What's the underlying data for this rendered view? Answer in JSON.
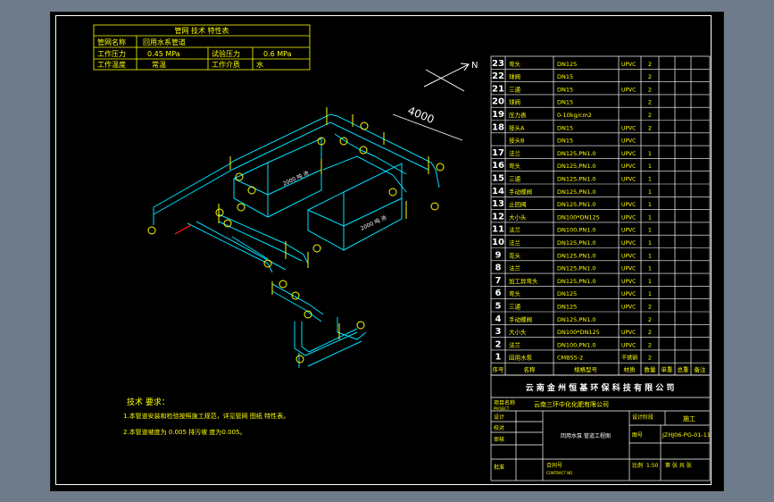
{
  "spec": {
    "title": "管网 技术 特性表",
    "rows": [
      [
        "管网名称",
        "回用水系管道",
        "",
        ""
      ],
      [
        "工作压力",
        "0.45 MPa",
        "试验压力",
        "0.6 MPa"
      ],
      [
        "工作温度",
        "常温",
        "工作介质",
        "水"
      ]
    ]
  },
  "north": "N",
  "dim_main": "4000",
  "tanks": [
    {
      "label": "2000 吨 池"
    },
    {
      "label": "2000 吨 池"
    }
  ],
  "notes": {
    "title": "技术 要求：",
    "items": [
      "1.本管道安装和检验按照施工规范，详见管网 图纸 特性表。",
      "2.本管道坡度为 0.005 排污坡 度为0.005。"
    ]
  },
  "bom": {
    "rows": [
      {
        "no": "23",
        "name": "弯头",
        "spec": "DN125",
        "mat": "UPVC",
        "qty": "2"
      },
      {
        "no": "22",
        "name": "球阀",
        "spec": "DN15",
        "mat": "",
        "qty": "2"
      },
      {
        "no": "21",
        "name": "三通",
        "spec": "DN15",
        "mat": "UPVC",
        "qty": "2"
      },
      {
        "no": "20",
        "name": "球阀",
        "spec": "DN15",
        "mat": "",
        "qty": "2"
      },
      {
        "no": "19",
        "name": "压力表",
        "spec": "0-10kg/cm2",
        "mat": "",
        "qty": "2"
      },
      {
        "no": "18",
        "name": "接头A",
        "spec": "DN15",
        "mat": "UPVC",
        "qty": "2"
      },
      {
        "no": "",
        "name": "接头B",
        "spec": "DN15",
        "mat": "UPVC",
        "qty": ""
      },
      {
        "no": "17",
        "name": "法兰",
        "spec": "DN125,PN1.0",
        "mat": "UPVC",
        "qty": "1"
      },
      {
        "no": "16",
        "name": "弯头",
        "spec": "DN125,PN1.0",
        "mat": "UPVC",
        "qty": "1"
      },
      {
        "no": "15",
        "name": "三通",
        "spec": "DN125,PN1.0",
        "mat": "UPVC",
        "qty": "1"
      },
      {
        "no": "14",
        "name": "手动蝶阀",
        "spec": "DN125,PN1.0",
        "mat": "",
        "qty": "1"
      },
      {
        "no": "13",
        "name": "止回阀",
        "spec": "DN125,PN1.0",
        "mat": "UPVC",
        "qty": "1"
      },
      {
        "no": "12",
        "name": "大小头",
        "spec": "DN100*DN125",
        "mat": "UPVC",
        "qty": "1"
      },
      {
        "no": "11",
        "name": "法兰",
        "spec": "DN100,PN1.0",
        "mat": "UPVC",
        "qty": "1"
      },
      {
        "no": "10",
        "name": "法兰",
        "spec": "DN125,PN1.0",
        "mat": "UPVC",
        "qty": "1"
      },
      {
        "no": "9",
        "name": "弯头",
        "spec": "DN125,PN1.0",
        "mat": "UPVC",
        "qty": "1"
      },
      {
        "no": "8",
        "name": "法兰",
        "spec": "DN125,PN1.0",
        "mat": "UPVC",
        "qty": "1"
      },
      {
        "no": "7",
        "name": "加工异弯头",
        "spec": "DN125,PN1.0",
        "mat": "UPVC",
        "qty": "1"
      },
      {
        "no": "6",
        "name": "弯头",
        "spec": "DN125",
        "mat": "UPVC",
        "qty": "1"
      },
      {
        "no": "5",
        "name": "三通",
        "spec": "DN125",
        "mat": "UPVC",
        "qty": "2"
      },
      {
        "no": "4",
        "name": "手动蝶阀",
        "spec": "DN125,PN1.0",
        "mat": "",
        "qty": "2"
      },
      {
        "no": "3",
        "name": "大小头",
        "spec": "DN100*DN125",
        "mat": "UPVC",
        "qty": "2"
      },
      {
        "no": "2",
        "name": "法兰",
        "spec": "DN100,PN1.0",
        "mat": "UPVC",
        "qty": "2"
      },
      {
        "no": "1",
        "name": "回用水泵",
        "spec": "CMBS5-2",
        "mat": "不锈钢",
        "qty": "2"
      }
    ],
    "header": {
      "no": "序号",
      "name": "名称",
      "spec": "规格型号",
      "mat": "材质",
      "qty": "数量",
      "unit": "单重",
      "total": "总重",
      "remark": "备注"
    }
  },
  "title_block": {
    "company": "云 南 金 州 恒 基 环 保 科 技 有 限 公 司",
    "project_label": "项目名称",
    "project_en": "PROJECT",
    "project": "云南三环中化化肥有限公司",
    "design": "设计",
    "check": "校对",
    "review": "审核",
    "approve": "批准",
    "drawing_title": "回用水泵 管道工程图",
    "drawing_no_label": "图号",
    "drawing_no": "JZHJ06-PG-01-11",
    "stage_label": "设计阶段",
    "stage": "施工",
    "scale_label": "比例",
    "scale": "1:50",
    "sheet_label": "第 张 共 张",
    "contract": "合同号",
    "contract_en": "CONTRACT NO"
  }
}
